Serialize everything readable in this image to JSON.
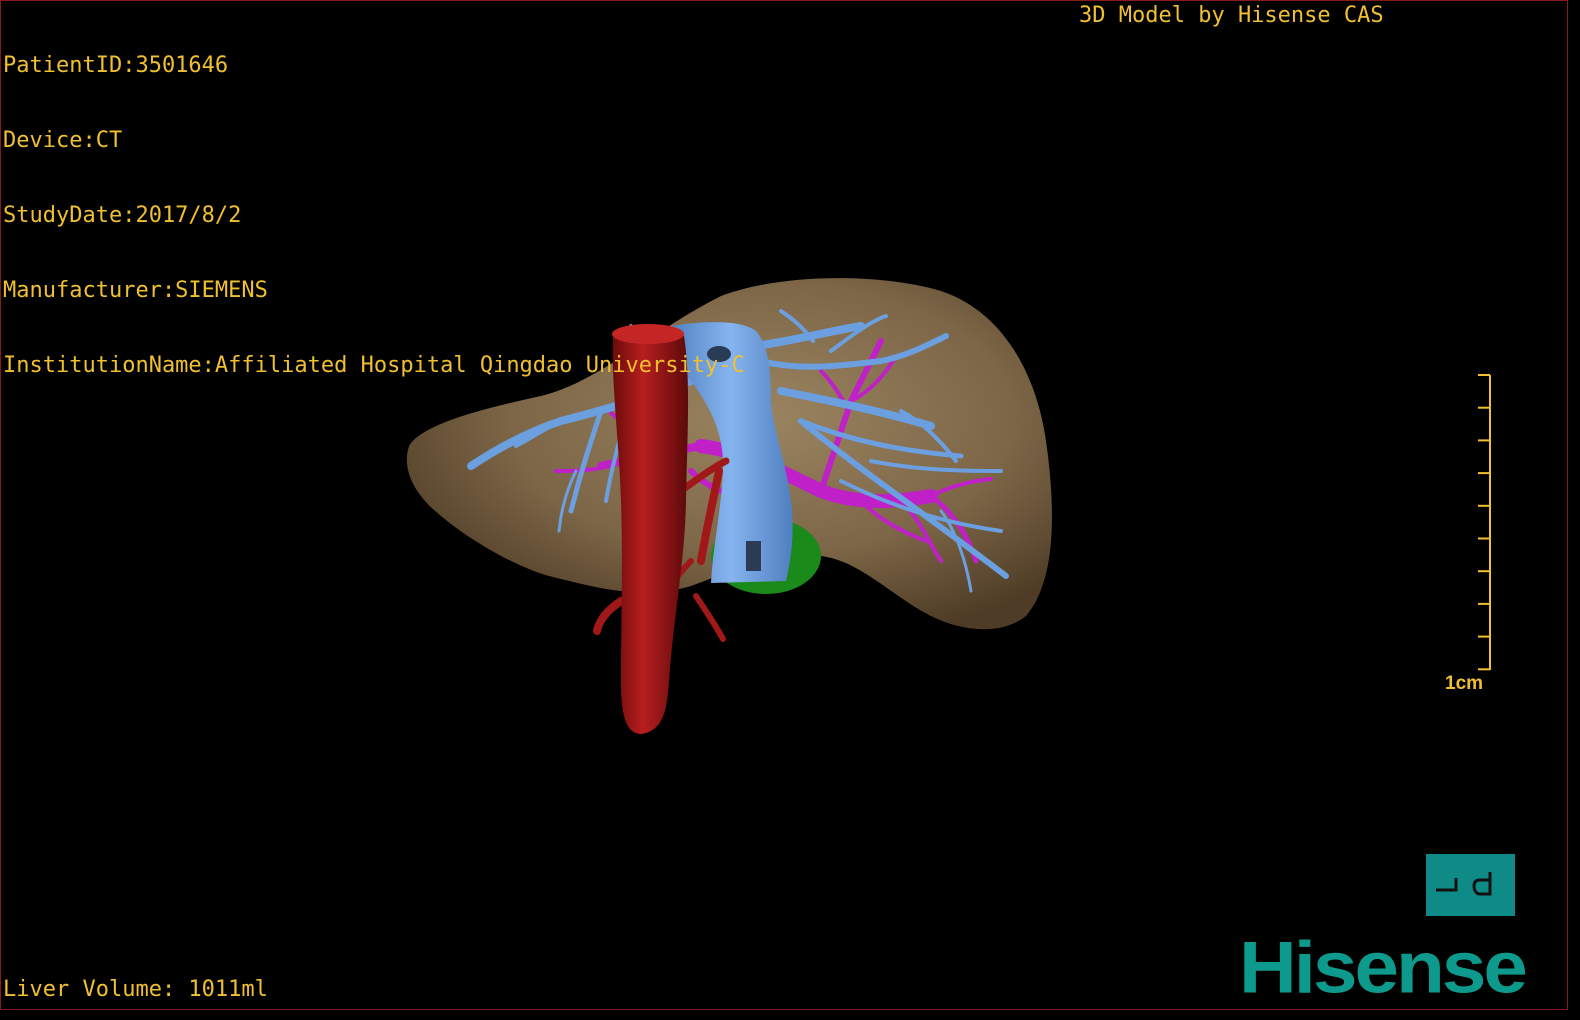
{
  "overlay": {
    "patient_id": "PatientID:3501646",
    "device": "Device:CT",
    "study_date": "StudyDate:2017/8/2",
    "manufacturer": "Manufacturer:SIEMENS",
    "institution": "InstitutionName:Affiliated Hospital Qingdao University-C",
    "credit": "3D Model by Hisense CAS",
    "liver_volume": "Liver Volume: 1011ml"
  },
  "scale_bar": {
    "label": "1cm"
  },
  "orientation_button": {
    "icon": "orientation-cube-icon"
  },
  "logo": {
    "text": "Hisense"
  },
  "colors": {
    "overlay_text": "#f0c030",
    "liver": "#8a7352",
    "aorta": "#a01818",
    "hepatic_vein": "#6c9fe0",
    "portal_vein": "#c020c8",
    "gallbladder": "#1a8a1a",
    "brand": "#0d9a8c",
    "frame": "#8a1a1a"
  }
}
